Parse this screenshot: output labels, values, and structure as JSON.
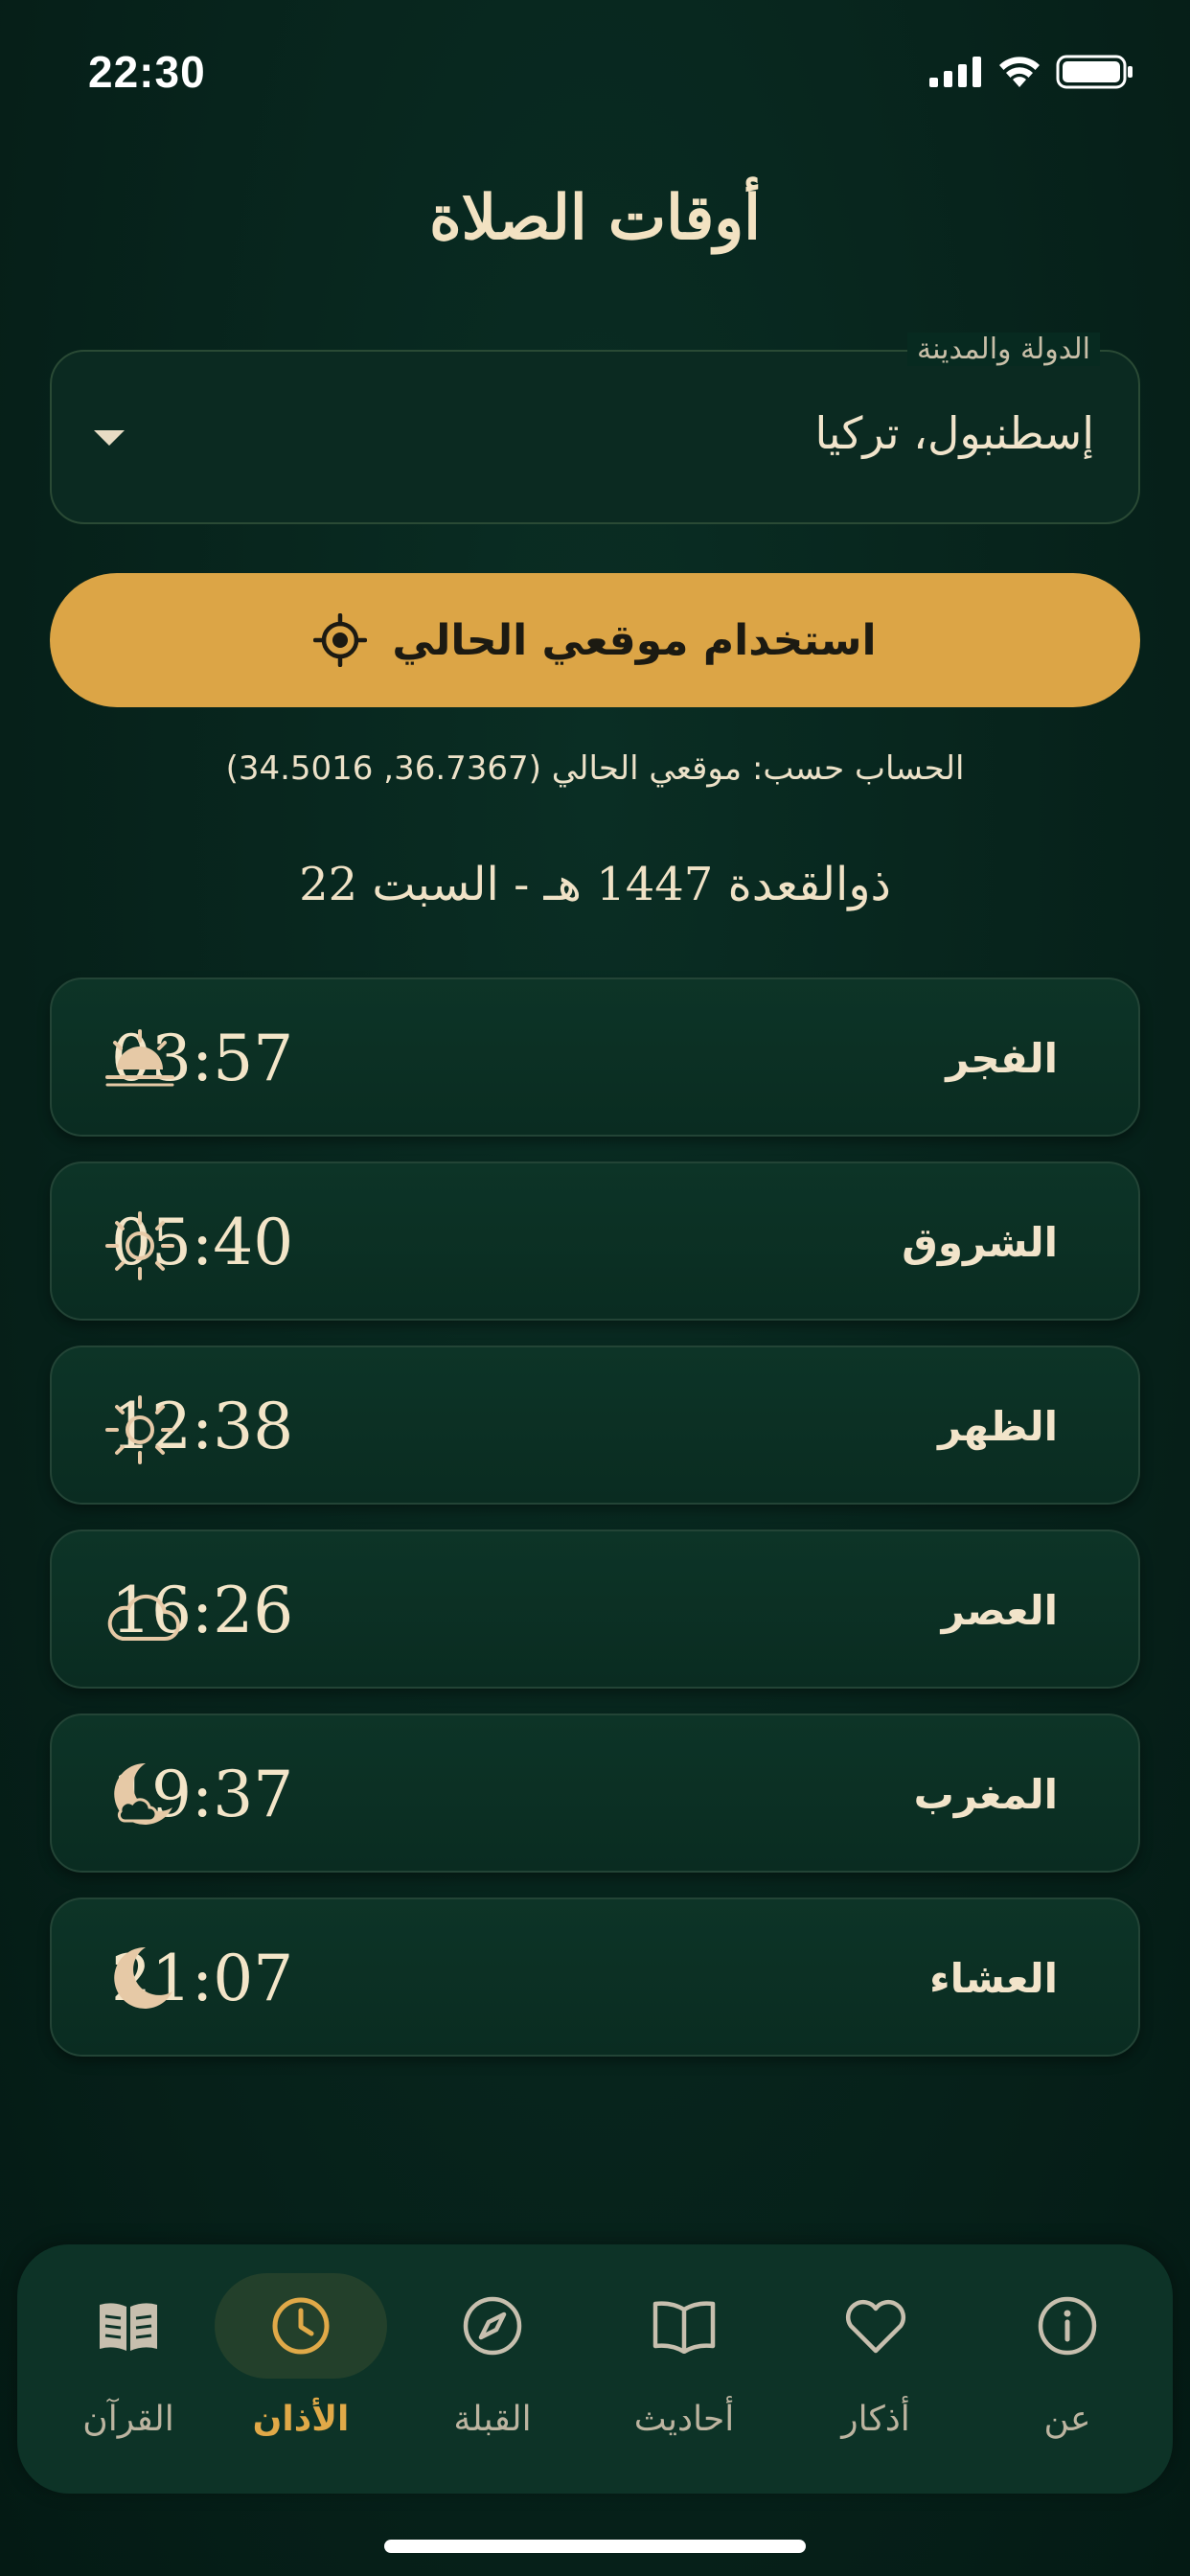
{
  "status_bar": {
    "time": "22:30"
  },
  "header": {
    "title": "أوقات الصلاة"
  },
  "location": {
    "label": "الدولة والمدينة",
    "value": "إسطنبول، تركيا"
  },
  "use_location_button": {
    "label": "استخدام موقعي الحالي"
  },
  "calculation_note": "الحساب حسب: موقعي الحالي (36.7367, 34.5016)",
  "hijri_date": "ذوالقعدة 1447 هـ - السبت 22",
  "prayers": [
    {
      "name": "الفجر",
      "time": "03:57",
      "icon": "sunrise-icon"
    },
    {
      "name": "الشروق",
      "time": "05:40",
      "icon": "sun-icon"
    },
    {
      "name": "الظهر",
      "time": "12:38",
      "icon": "sun-icon"
    },
    {
      "name": "العصر",
      "time": "16:26",
      "icon": "cloud-icon"
    },
    {
      "name": "المغرب",
      "time": "19:37",
      "icon": "crescent-cloud-icon"
    },
    {
      "name": "العشاء",
      "time": "21:07",
      "icon": "moon-icon"
    }
  ],
  "bottom_nav": {
    "active": "adhan",
    "items": [
      {
        "id": "about",
        "label": "عن",
        "icon": "info-icon"
      },
      {
        "id": "adhkar",
        "label": "أذكار",
        "icon": "heart-icon"
      },
      {
        "id": "hadith",
        "label": "أحاديث",
        "icon": "open-book-icon"
      },
      {
        "id": "qibla",
        "label": "القبلة",
        "icon": "compass-icon"
      },
      {
        "id": "adhan",
        "label": "الأذان",
        "icon": "clock-icon"
      },
      {
        "id": "quran",
        "label": "القرآن",
        "icon": "quran-book-icon"
      }
    ]
  },
  "colors": {
    "background": "#07241c",
    "card": "#0b2e23",
    "accent": "#dca546",
    "text": "#f2e4ca",
    "icon": "#e6c9a6"
  }
}
